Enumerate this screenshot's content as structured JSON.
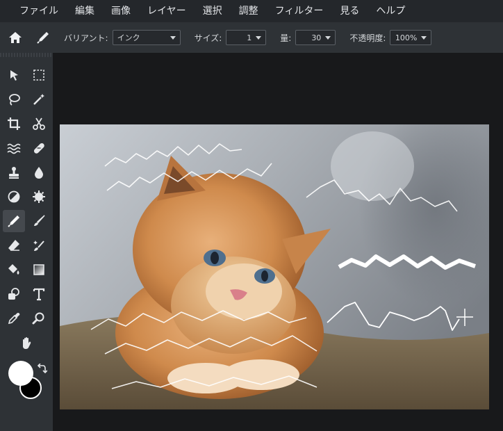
{
  "menu": {
    "items": [
      "ファイル",
      "編集",
      "画像",
      "レイヤー",
      "選択",
      "調整",
      "フィルター",
      "見る",
      "ヘルプ"
    ]
  },
  "options": {
    "variant_label": "バリアント:",
    "variant_value": "インク",
    "size_label": "サイズ:",
    "size_value": "1",
    "amount_label": "量:",
    "amount_value": "30",
    "opacity_label": "不透明度:",
    "opacity_value": "100%"
  },
  "tools": [
    {
      "name": "move-tool",
      "icon": "arrow-icon"
    },
    {
      "name": "marquee-tool",
      "icon": "dashed-rectangle-icon"
    },
    {
      "name": "lasso-tool",
      "icon": "lasso-icon"
    },
    {
      "name": "magic-wand-tool",
      "icon": "magic-wand-icon"
    },
    {
      "name": "crop-tool",
      "icon": "crop-icon"
    },
    {
      "name": "cut-tool",
      "icon": "scissors-icon"
    },
    {
      "name": "liquify-tool",
      "icon": "waves-icon"
    },
    {
      "name": "healing-tool",
      "icon": "bandage-icon"
    },
    {
      "name": "clone-stamp-tool",
      "icon": "stamp-icon"
    },
    {
      "name": "blur-tool",
      "icon": "drop-icon"
    },
    {
      "name": "dodge-tool",
      "icon": "half-circle-icon"
    },
    {
      "name": "sponge-tool",
      "icon": "sponge-icon"
    },
    {
      "name": "pencil-tool",
      "icon": "pen-icon"
    },
    {
      "name": "brush-tool",
      "icon": "brush-icon"
    },
    {
      "name": "eraser-tool",
      "icon": "eraser-icon"
    },
    {
      "name": "smart-brush-tool",
      "icon": "sparkle-brush-icon"
    },
    {
      "name": "fill-tool",
      "icon": "paint-bucket-icon"
    },
    {
      "name": "gradient-tool",
      "icon": "gradient-icon"
    },
    {
      "name": "shape-tool",
      "icon": "shapes-icon"
    },
    {
      "name": "text-tool",
      "icon": "text-icon"
    },
    {
      "name": "eyedropper-tool",
      "icon": "eyedropper-icon"
    },
    {
      "name": "zoom-tool",
      "icon": "magnifier-icon"
    },
    {
      "name": "hand-tool",
      "icon": "hand-icon"
    }
  ],
  "colors": {
    "foreground": "#ffffff",
    "background": "#000000",
    "menubar": "#24272b",
    "panel": "#2e3236",
    "workspace": "#18191b"
  }
}
